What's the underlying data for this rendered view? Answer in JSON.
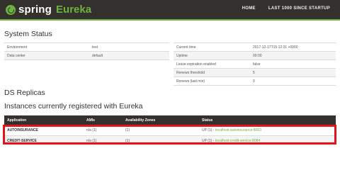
{
  "brand": {
    "spring": "spring",
    "eureka": "Eureka"
  },
  "nav": {
    "home": "HOME",
    "last1000": "LAST 1000 SINCE STARTUP"
  },
  "system_status": {
    "title": "System Status",
    "left_rows": [
      {
        "label": "Environment",
        "value": "test"
      },
      {
        "label": "Data center",
        "value": "default"
      }
    ],
    "right_rows": [
      {
        "label": "Current time",
        "value": "2017-12-17T15:12:31 +0900"
      },
      {
        "label": "Uptime",
        "value": "00:00"
      },
      {
        "label": "Lease expiration enabled",
        "value": "false"
      },
      {
        "label": "Renews threshold",
        "value": "5"
      },
      {
        "label": "Renews (last min)",
        "value": "0"
      }
    ]
  },
  "ds_replicas": {
    "title": "DS Replicas"
  },
  "instances": {
    "title": "Instances currently registered with Eureka",
    "columns": [
      "Application",
      "AMIs",
      "Availability Zones",
      "Status"
    ],
    "rows": [
      {
        "application": "AUTOINSURANCE",
        "amis": "n/a (1)",
        "zones": "(1)",
        "status_prefix": "UP (1) - ",
        "status_link": "localhost:autoinsurance:8083"
      },
      {
        "application": "CREDIT-SERVICE",
        "amis": "n/a (1)",
        "zones": "(1)",
        "status_prefix": "UP (1) - ",
        "status_link": "localhost:credit-service:8084"
      }
    ]
  },
  "colors": {
    "nav_bg": "#34302d",
    "accent": "#6db33f",
    "highlight": "#e2141b"
  }
}
